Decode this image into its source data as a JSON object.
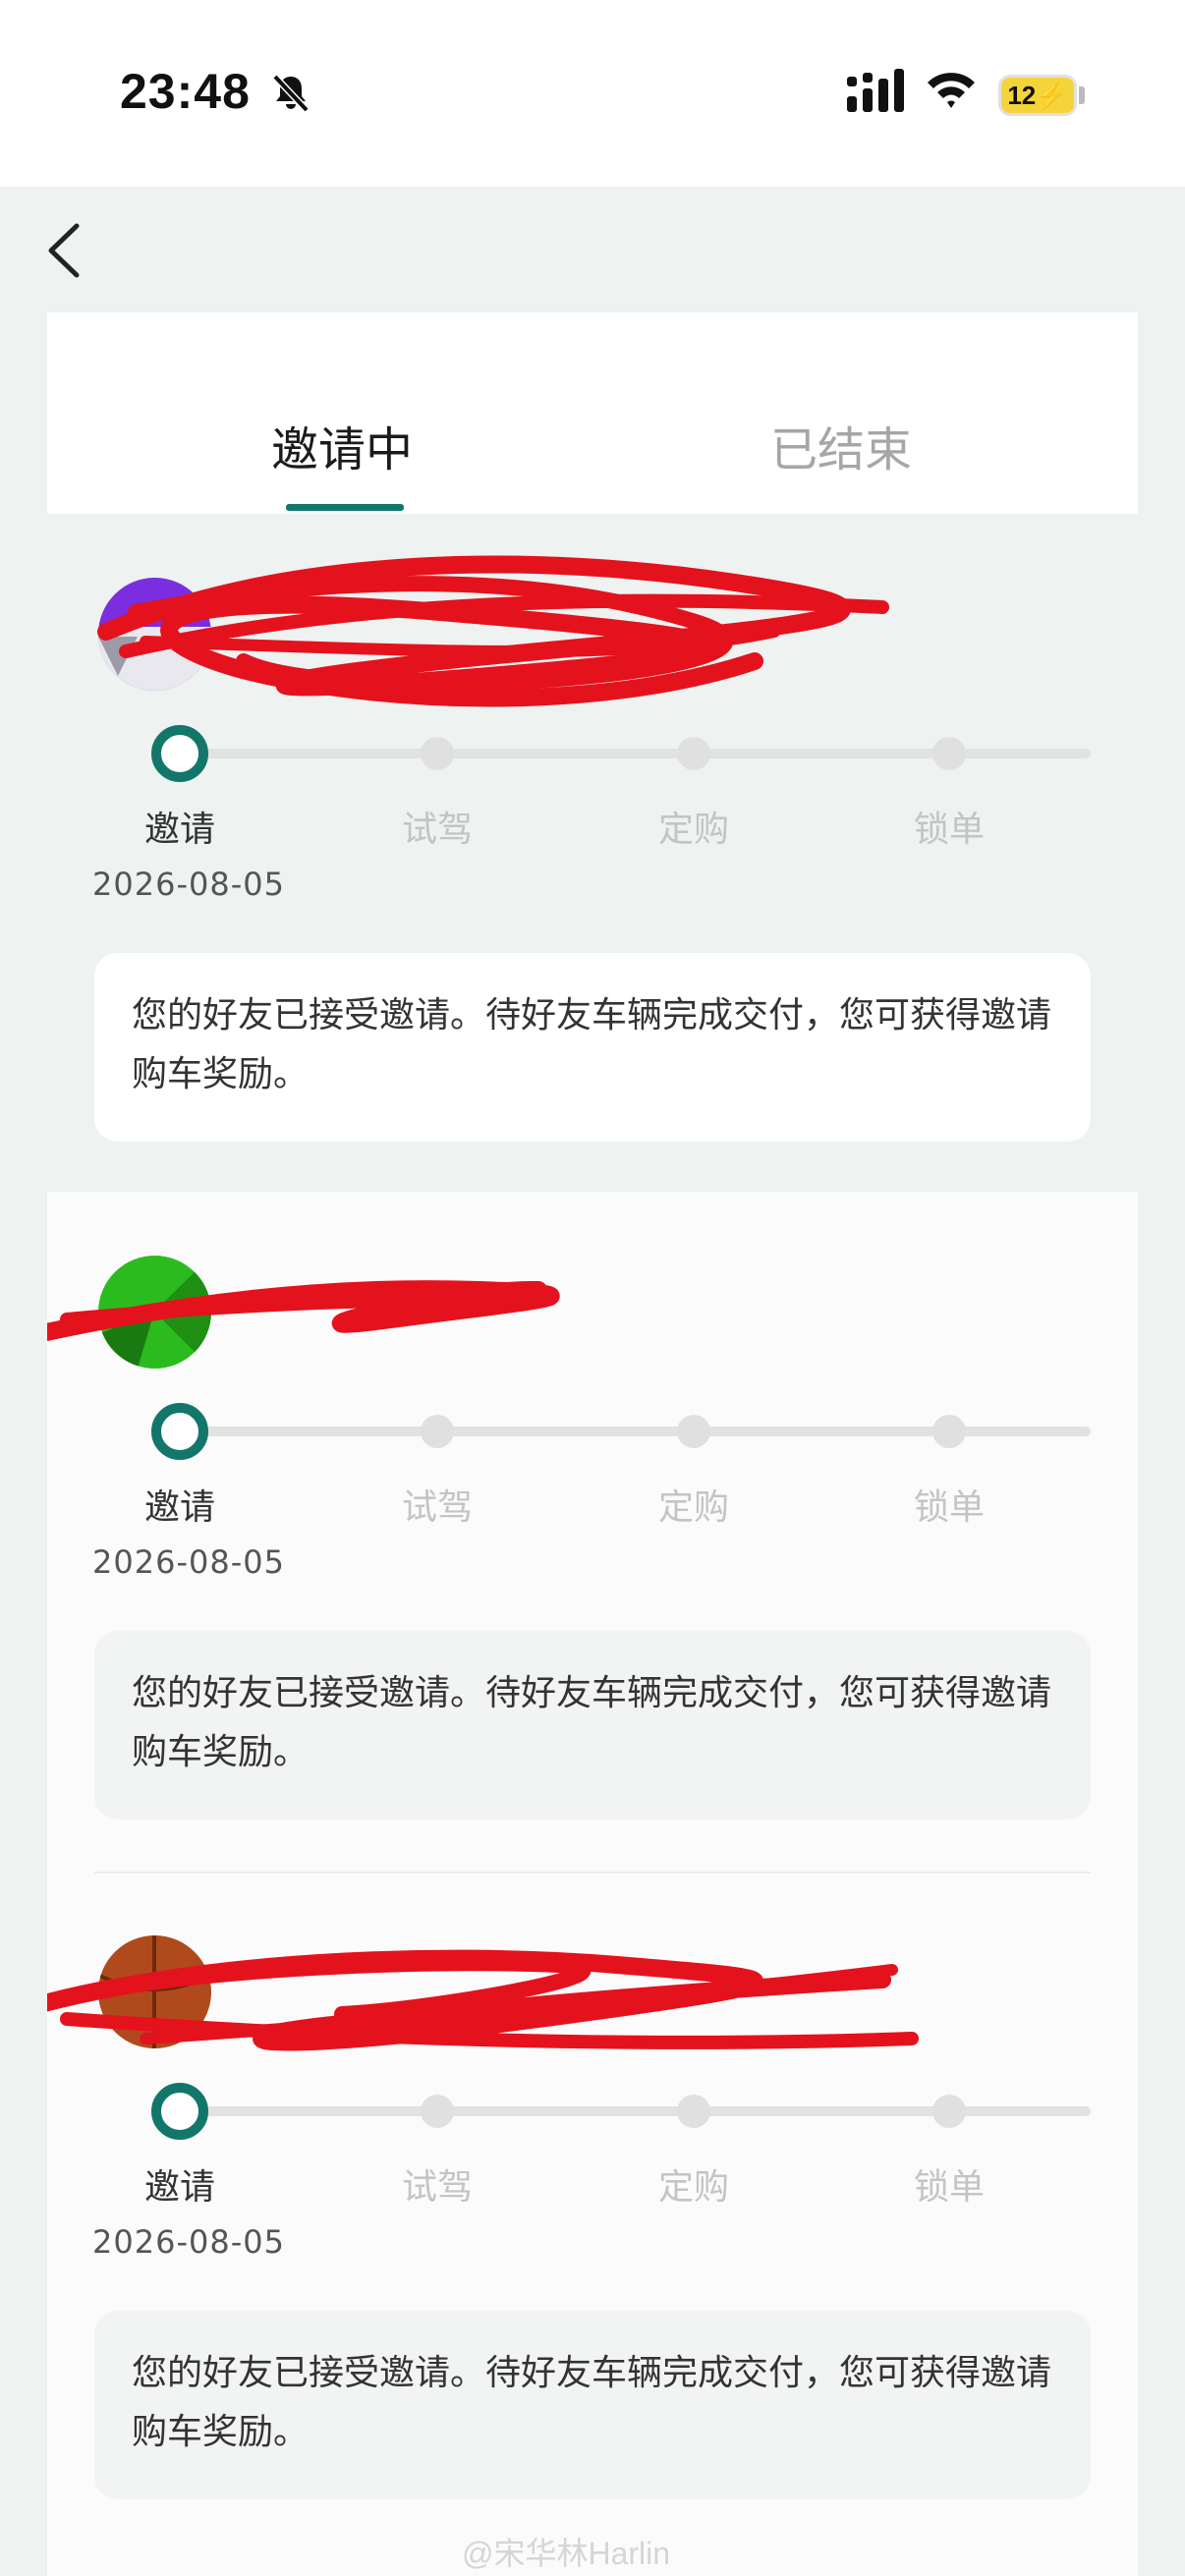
{
  "status_bar": {
    "time": "23:48",
    "battery": "12",
    "icons": [
      "bell-muted-icon",
      "signal-icon",
      "wifi-icon",
      "battery-charging-icon"
    ]
  },
  "header": {
    "back_icon": "chevron-left-icon"
  },
  "tabs": [
    {
      "label": "邀请中",
      "active": true
    },
    {
      "label": "已结束",
      "active": false
    }
  ],
  "accent_color": "#13766a",
  "steps": [
    "邀请",
    "试驾",
    "定购",
    "锁单"
  ],
  "entries": [
    {
      "avatar_color": "#7b2ee0",
      "name": "",
      "current_step": 0,
      "date": "2026-08-05",
      "message": "您的好友已接受邀请。待好友车辆完成交付，您可获得邀请购车奖励。"
    },
    {
      "avatar_color": "#2bbb1e",
      "name": "",
      "current_step": 0,
      "date": "2026-08-05",
      "message": "您的好友已接受邀请。待好友车辆完成交付，您可获得邀请购车奖励。"
    },
    {
      "avatar_color": "#b04a1c",
      "name": "",
      "current_step": 0,
      "date": "2026-08-05",
      "message": "您的好友已接受邀请。待好友车辆完成交付，您可获得邀请购车奖励。"
    }
  ],
  "watermark": "@宋华林Harlin"
}
